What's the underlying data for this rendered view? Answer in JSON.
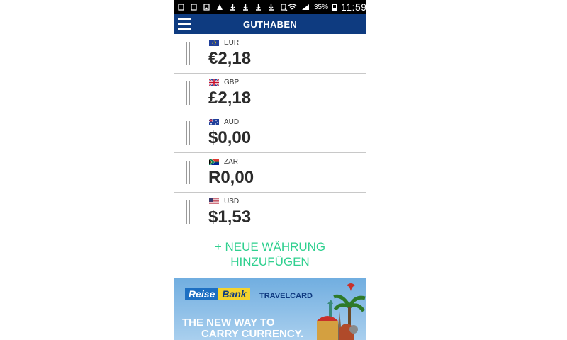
{
  "status": {
    "battery": "35%",
    "time": "11:59"
  },
  "header": {
    "title": "GUTHABEN"
  },
  "currencies": [
    {
      "code": "EUR",
      "amount": "€2,18",
      "flag": "eu-flag-icon"
    },
    {
      "code": "GBP",
      "amount": "£2,18",
      "flag": "uk-flag-icon"
    },
    {
      "code": "AUD",
      "amount": "$0,00",
      "flag": "australia-flag-icon"
    },
    {
      "code": "ZAR",
      "amount": "R0,00",
      "flag": "south-africa-flag-icon"
    },
    {
      "code": "USD",
      "amount": "$1,53",
      "flag": "usa-flag-icon"
    }
  ],
  "add_currency": {
    "line1": "+ NEUE WÄHRUNG",
    "line2": "HINZUFÜGEN",
    "color": "#2fd08f"
  },
  "ad": {
    "logo_part1": "Reise",
    "logo_part2": "Bank",
    "brand": "TRAVELCARD",
    "slogan_line1": "THE NEW WAY TO",
    "slogan_line2": "CARRY CURRENCY."
  },
  "colors": {
    "appbar": "#0e3b80",
    "accent": "#2fd08f"
  }
}
